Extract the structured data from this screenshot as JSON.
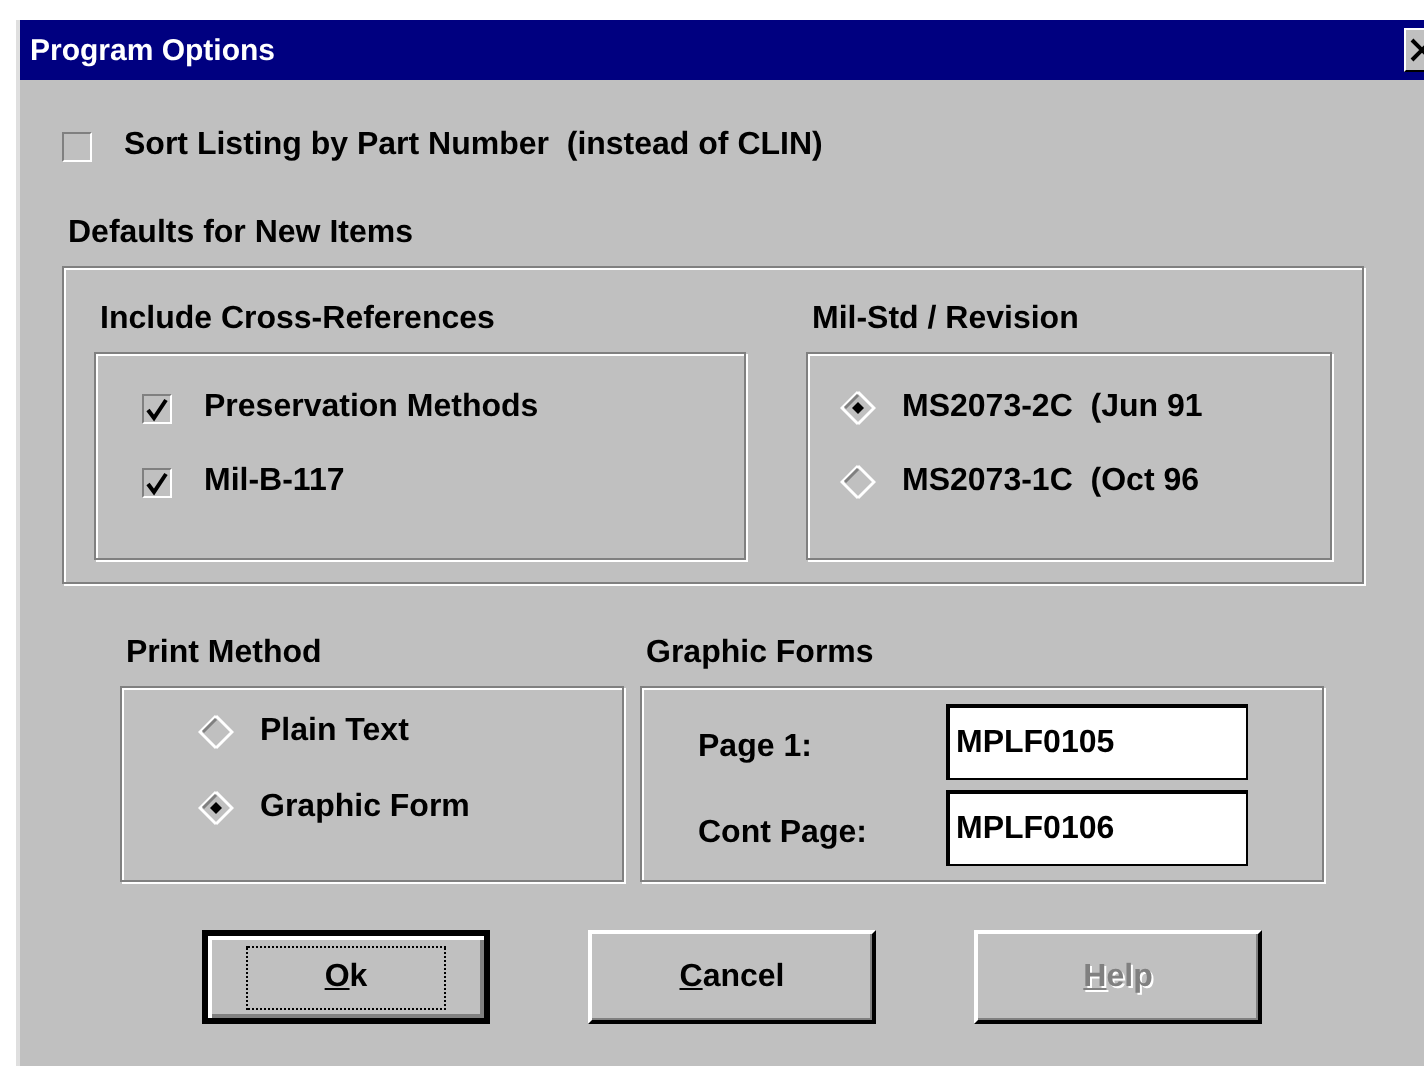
{
  "window": {
    "title": "Program Options"
  },
  "sort_by_part_number": {
    "label": "Sort Listing by Part Number  (instead of CLIN)",
    "checked": false
  },
  "defaults": {
    "title": "Defaults for New Items",
    "cross_references": {
      "title": "Include Cross-References",
      "items": [
        {
          "label": "Preservation Methods",
          "checked": true
        },
        {
          "label": "Mil-B-117",
          "checked": true
        }
      ]
    },
    "revision": {
      "title": "Mil-Std / Revision",
      "options": [
        {
          "label": "MS2073-2C  (Jun 91",
          "selected": true
        },
        {
          "label": "MS2073-1C  (Oct 96",
          "selected": false
        }
      ]
    }
  },
  "print_method": {
    "title": "Print Method",
    "options": [
      {
        "label": "Plain Text",
        "selected": false
      },
      {
        "label": "Graphic Form",
        "selected": true
      }
    ]
  },
  "graphic_forms": {
    "title": "Graphic Forms",
    "fields": [
      {
        "label": "Page 1:",
        "value": "MPLF0105"
      },
      {
        "label": "Cont Page:",
        "value": "MPLF0106"
      }
    ]
  },
  "buttons": [
    {
      "label": "Ok",
      "default": true,
      "disabled": false
    },
    {
      "label": "Cancel",
      "default": false,
      "disabled": false
    },
    {
      "label": "Help",
      "default": false,
      "disabled": true
    }
  ]
}
